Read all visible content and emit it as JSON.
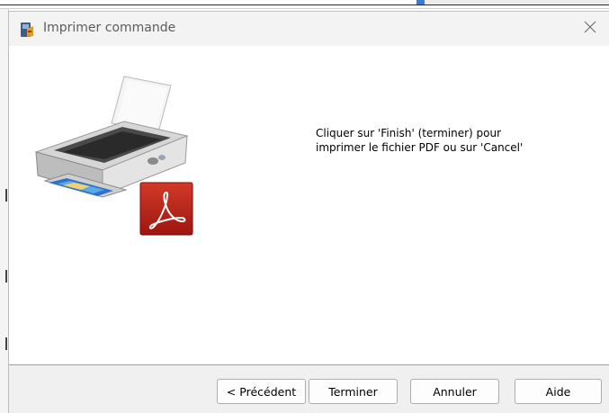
{
  "window": {
    "title": "Imprimer commande",
    "title_icon": "installer-icon",
    "close_icon": "close-icon"
  },
  "content": {
    "message_line1": "Cliquer sur 'Finish' (terminer) pour",
    "message_line2": "imprimer le fichier PDF ou sur 'Cancel'",
    "printer_icon": "printer-icon",
    "pdf_icon": "pdf-icon"
  },
  "buttons": {
    "back": "< Précédent",
    "finish": "Terminer",
    "cancel": "Annuler",
    "help": "Aide"
  },
  "colors": {
    "titlebar_bg": "#f3f3f3",
    "button_bar_bg": "#f0f0f0",
    "pdf_red": "#c0201a"
  }
}
